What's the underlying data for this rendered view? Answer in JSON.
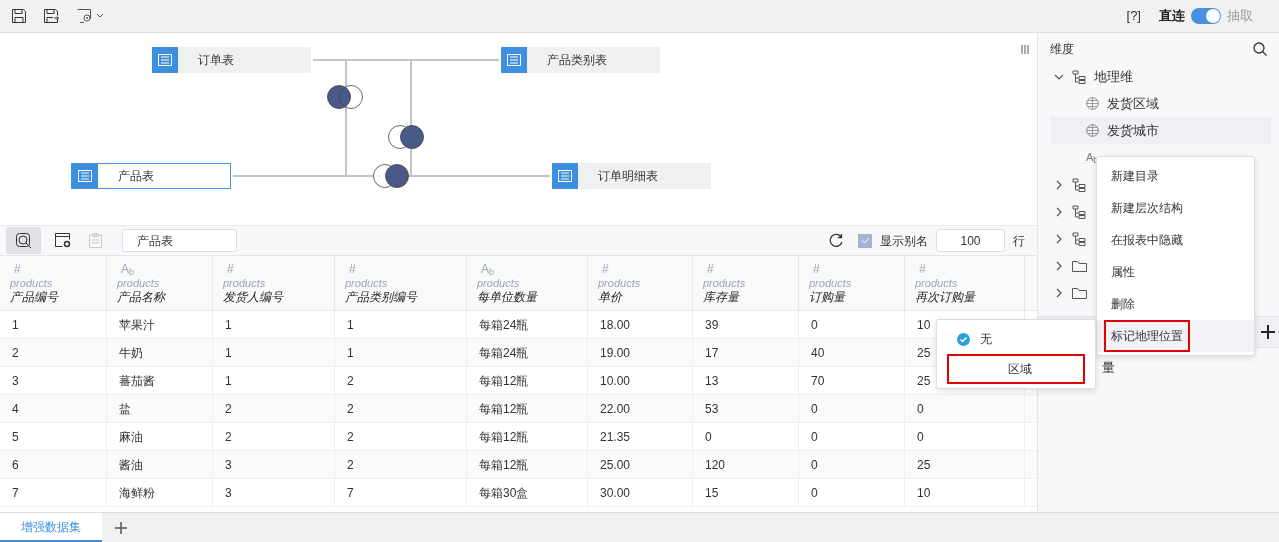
{
  "toolbar": {
    "help": "[?]",
    "mode_left": "直连",
    "mode_on": true,
    "mode_right": "抽取"
  },
  "diagram": {
    "nodes": [
      {
        "label": "订单表",
        "selected": false
      },
      {
        "label": "产品类别表",
        "selected": false
      },
      {
        "label": "产品表",
        "selected": true
      },
      {
        "label": "订单明细表",
        "selected": false
      }
    ],
    "joins": [
      {
        "kind": "left"
      },
      {
        "kind": "right"
      },
      {
        "kind": "right"
      }
    ]
  },
  "data_toolbar": {
    "preview_selected": true,
    "table_name": "产品表",
    "show_alias": true,
    "show_alias_label": "显示别名",
    "row_count": "100",
    "rows_label": "行"
  },
  "table": {
    "columns": [
      {
        "type_icon": "#",
        "source": "products",
        "name": "产品编号"
      },
      {
        "type_icon": "A$_{b}$",
        "source": "products",
        "name": "产品名称"
      },
      {
        "type_icon": "#",
        "source": "products",
        "name": "发货人编号"
      },
      {
        "type_icon": "#",
        "source": "products",
        "name": "产品类别编号"
      },
      {
        "type_icon": "A$_{b}$",
        "source": "products",
        "name": "每单位数量"
      },
      {
        "type_icon": "#",
        "source": "products",
        "name": "单价"
      },
      {
        "type_icon": "#",
        "source": "products",
        "name": "库存量"
      },
      {
        "type_icon": "#",
        "source": "products",
        "name": "订购量"
      },
      {
        "type_icon": "#",
        "source": "products",
        "name": "再次订购量"
      }
    ],
    "rows": [
      [
        "1",
        "苹果汁",
        "1",
        "1",
        "每箱24瓶",
        "18.00",
        "39",
        "0",
        "10"
      ],
      [
        "2",
        "牛奶",
        "1",
        "1",
        "每箱24瓶",
        "19.00",
        "17",
        "40",
        "25"
      ],
      [
        "3",
        "蕃茄酱",
        "1",
        "2",
        "每箱12瓶",
        "10.00",
        "13",
        "70",
        "25"
      ],
      [
        "4",
        "盐",
        "2",
        "2",
        "每箱12瓶",
        "22.00",
        "53",
        "0",
        "0"
      ],
      [
        "5",
        "麻油",
        "2",
        "2",
        "每箱12瓶",
        "21.35",
        "0",
        "0",
        "0"
      ],
      [
        "6",
        "酱油",
        "3",
        "2",
        "每箱12瓶",
        "25.00",
        "120",
        "0",
        "25"
      ],
      [
        "7",
        "海鲜粉",
        "3",
        "7",
        "每箱30盒",
        "30.00",
        "15",
        "0",
        "10"
      ]
    ]
  },
  "sidebar": {
    "title": "维度",
    "tree": [
      {
        "kind": "hierarchy",
        "label": "地理维",
        "expanded": true,
        "children": [
          {
            "kind": "geo",
            "label": "发货区域",
            "selected": false
          },
          {
            "kind": "geo",
            "label": "发货城市",
            "selected": true
          },
          {
            "kind": "text",
            "icon": "A$_{b}$",
            "selected": false
          }
        ]
      },
      {
        "kind": "hierarchy",
        "expanded": false
      },
      {
        "kind": "hierarchy",
        "expanded": false
      },
      {
        "kind": "hierarchy",
        "expanded": false
      },
      {
        "kind": "folder",
        "expanded": false
      },
      {
        "kind": "folder",
        "expanded": false
      }
    ],
    "measure_item": "量"
  },
  "context_menu": {
    "items": [
      {
        "label": "新建目录",
        "highlighted": false
      },
      {
        "label": "新建层次结构",
        "highlighted": false
      },
      {
        "label": "在报表中隐藏",
        "highlighted": false
      },
      {
        "label": "属性",
        "highlighted": false
      },
      {
        "label": "删除",
        "highlighted": false
      },
      {
        "label": "标记地理位置",
        "highlighted": true
      }
    ]
  },
  "geo_menu": {
    "items": [
      {
        "label": "无",
        "checked": true,
        "highlighted": false
      },
      {
        "label": "区域",
        "checked": false,
        "highlighted": true
      }
    ]
  },
  "bottom_tabs": [
    {
      "label": "增强数据集",
      "selected": true
    }
  ]
}
